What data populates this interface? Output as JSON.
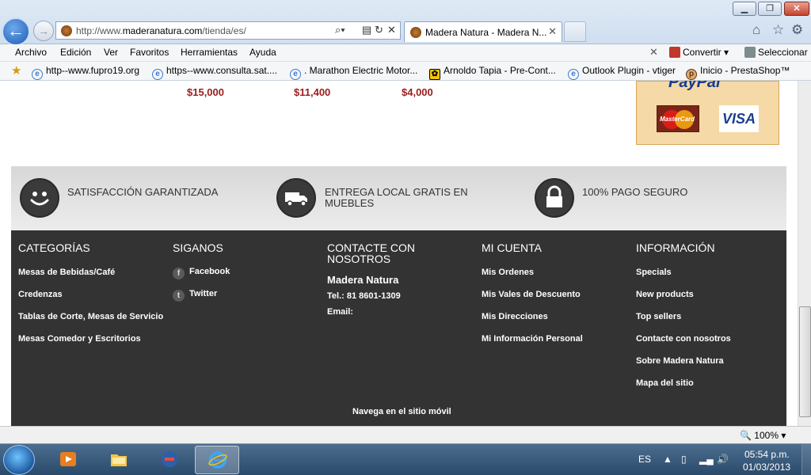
{
  "browser": {
    "url_prefix": "http://www.",
    "url_host": "maderanatura.com",
    "url_path": "/tienda/es/",
    "tab_title": "Madera Natura - Madera N...",
    "menu": [
      "Archivo",
      "Edición",
      "Ver",
      "Favoritos",
      "Herramientas",
      "Ayuda"
    ],
    "tools": {
      "convert": "Convertir",
      "select": "Seleccionar"
    },
    "favorites": [
      "http--www.fupro19.org",
      "https--www.consulta.sat....",
      ". Marathon Electric Motor...",
      "Arnoldo Tapia - Pre-Cont...",
      "Outlook Plugin - vtiger",
      "Inicio - PrestaShop™"
    ],
    "zoom": "100%"
  },
  "prices": [
    "$15,000",
    "$11,400",
    "$4,000"
  ],
  "payment": {
    "paypal_fragment": "PayPal",
    "mastercard": "MasterCard",
    "visa": "VISA"
  },
  "features": [
    {
      "icon": "smiley-icon",
      "text": "SATISFACCIÓN GARANTIZADA"
    },
    {
      "icon": "truck-icon",
      "text_line1": "ENTREGA LOCAL GRATIS EN",
      "text_line2": "MUEBLES"
    },
    {
      "icon": "lock-icon",
      "text": "100% PAGO SEGURO"
    }
  ],
  "footer": {
    "categorias": {
      "title": "CATEGORÍAS",
      "links": [
        "Mesas de Bebidas/Café",
        "Credenzas",
        "Tablas de Corte, Mesas de Servicio",
        "Mesas Comedor y Escritorios"
      ]
    },
    "siganos": {
      "title": "SIGANOS",
      "links": [
        "Facebook",
        "Twitter"
      ]
    },
    "contacto": {
      "title_line1": "CONTACTE CON",
      "title_line2": "NOSOTROS",
      "name": "Madera Natura",
      "tel": "Tel.: 81 8601-1309",
      "email": "Email:"
    },
    "cuenta": {
      "title": "MI CUENTA",
      "links": [
        "Mis Ordenes",
        "Mis Vales de Descuento",
        "Mis Direcciones",
        "Mi Información Personal"
      ]
    },
    "informacion": {
      "title": "INFORMACIÓN",
      "links": [
        "Specials",
        "New products",
        "Top sellers",
        "Contacte con nosotros",
        "Sobre Madera Natura",
        "Mapa del sitio"
      ]
    },
    "mobile": "Navega en el sitio móvil"
  },
  "taskbar": {
    "lang": "ES",
    "time": "05:54 p.m.",
    "date": "01/03/2013"
  }
}
